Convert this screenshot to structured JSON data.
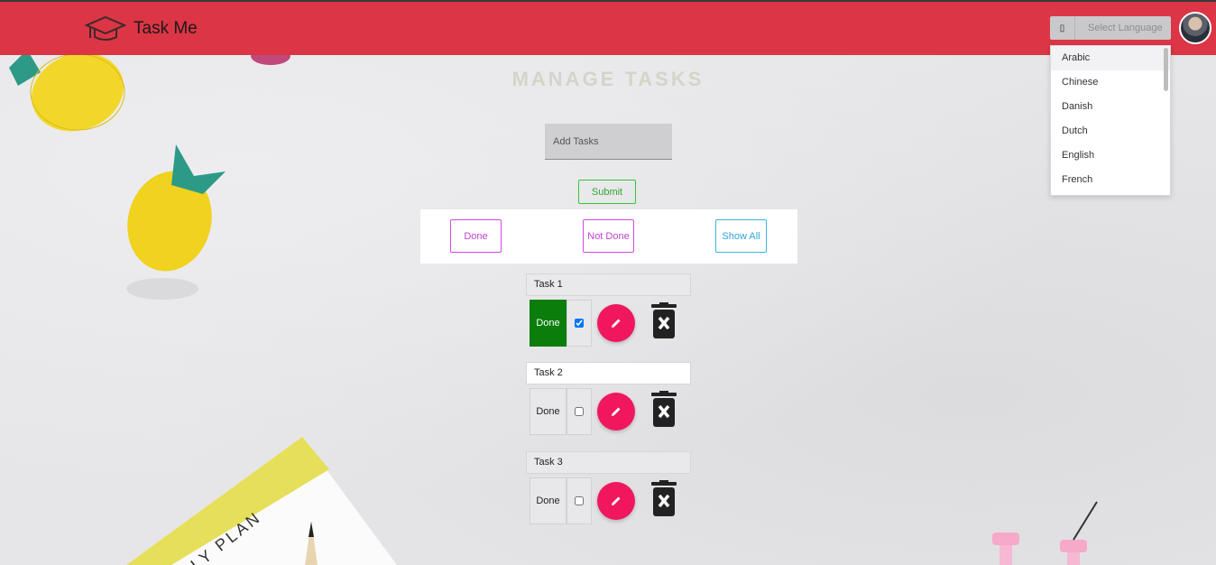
{
  "app": {
    "brand": "Task Me"
  },
  "language": {
    "placeholder": "Select Language",
    "button_glyph": "▯",
    "options": [
      "Arabic",
      "Chinese",
      "Danish",
      "Dutch",
      "English",
      "French"
    ]
  },
  "page": {
    "title": "MANAGE TASKS"
  },
  "add_task": {
    "placeholder": "Add Tasks",
    "submit_label": "Submit"
  },
  "filters": {
    "done": "Done",
    "not_done": "Not Done",
    "show_all": "Show All"
  },
  "tasks": [
    {
      "title": "Task 1",
      "status_label": "Done",
      "checked": true
    },
    {
      "title": "Task 2",
      "status_label": "Done",
      "checked": false
    },
    {
      "title": "Task 3",
      "status_label": "Done",
      "checked": false
    }
  ],
  "colors": {
    "navbar": "#dc3545",
    "done_active": "#0a7d0a",
    "edit": "#f0175e",
    "submit": "#39c539",
    "filter_purple": "#d04be0",
    "filter_blue": "#38b6ee"
  },
  "background_art": {
    "sticker_text": "LY PLAN"
  }
}
